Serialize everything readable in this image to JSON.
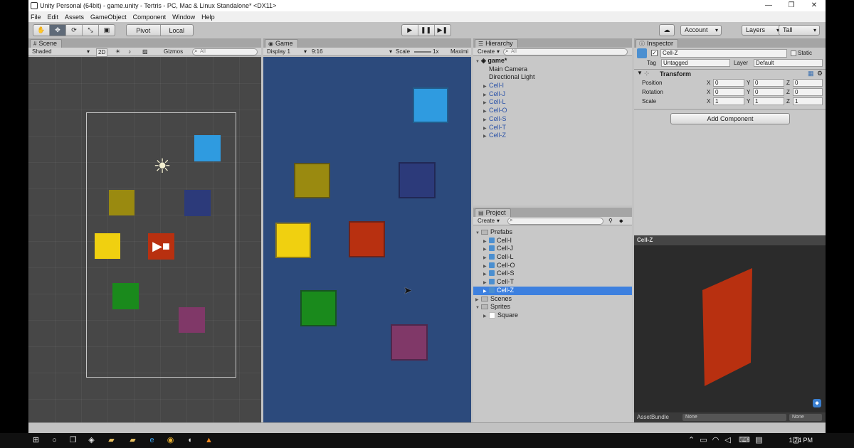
{
  "window": {
    "title": "Unity Personal (64bit) - game.unity - Tertris - PC, Mac & Linux Standalone* <DX11>"
  },
  "menu": [
    "File",
    "Edit",
    "Assets",
    "GameObject",
    "Component",
    "Window",
    "Help"
  ],
  "toolbar": {
    "pivot": "Pivot",
    "local": "Local",
    "account": "Account",
    "layers": "Layers",
    "layout": "Tall"
  },
  "scene": {
    "tab": "Scene",
    "shading": "Shaded",
    "mode2d": "2D",
    "gizmos": "Gizmos",
    "search_placeholder": "All",
    "colors": {
      "cyan": "#2f9be0",
      "olive": "#9a8a10",
      "navy": "#2c3a7a",
      "yellow": "#f0d010",
      "red": "#b83010",
      "green": "#1a8a1c",
      "purple": "#803868"
    }
  },
  "game": {
    "tab": "Game",
    "display": "Display 1",
    "aspect": "9:16",
    "scale_label": "Scale",
    "scale_value": "1x",
    "maximize": "Maximi",
    "background": "#2c4a7c"
  },
  "hierarchy": {
    "tab": "Hierarchy",
    "create": "Create",
    "search_placeholder": "All",
    "scene_name": "game*",
    "items": [
      "Main Camera",
      "Directional Light",
      "Cell-I",
      "Cell-J",
      "Cell-L",
      "Cell-O",
      "Cell-S",
      "Cell-T",
      "Cell-Z"
    ]
  },
  "project": {
    "tab": "Project",
    "create": "Create",
    "folders": [
      {
        "name": "Prefabs",
        "children": [
          "Cell-I",
          "Cell-J",
          "Cell-L",
          "Cell-O",
          "Cell-S",
          "Cell-T",
          "Cell-Z"
        ]
      },
      {
        "name": "Scenes"
      },
      {
        "name": "Sprites",
        "children": [
          "Square"
        ]
      }
    ],
    "selected": "Cell-Z"
  },
  "inspector": {
    "tab": "Inspector",
    "object_name": "Cell-Z",
    "static_label": "Static",
    "tag_label": "Tag",
    "tag_value": "Untagged",
    "layer_label": "Layer",
    "layer_value": "Default",
    "component": "Transform",
    "position_label": "Position",
    "rotation_label": "Rotation",
    "scale_label": "Scale",
    "axes": [
      "X",
      "Y",
      "Z"
    ],
    "position": [
      "0",
      "0",
      "0"
    ],
    "rotation": [
      "0",
      "0",
      "0"
    ],
    "scale": [
      "1",
      "1",
      "1"
    ],
    "add_component": "Add Component"
  },
  "preview": {
    "title": "Cell-Z",
    "asset_bundle_label": "AssetBundle",
    "bundle_value": "None",
    "variant_value": "None",
    "color": "#b83010"
  },
  "taskbar": {
    "time": "1:24 PM"
  }
}
